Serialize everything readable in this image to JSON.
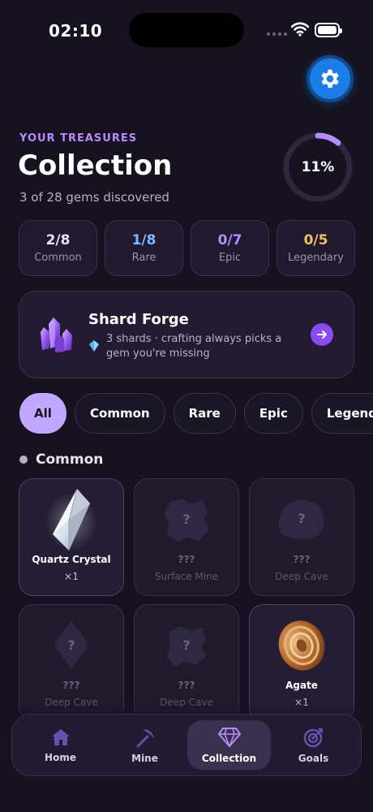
{
  "status_bar": {
    "time": "02:10"
  },
  "header": {
    "eyebrow": "YOUR TREASURES",
    "title": "Collection",
    "subtitle": "3 of 28 gems discovered",
    "progress_percent": 11,
    "progress_label": "11%"
  },
  "stats": [
    {
      "value": "2/8",
      "label": "Common",
      "color": "#e8e4f0"
    },
    {
      "value": "1/8",
      "label": "Rare",
      "color": "#7ab8ff"
    },
    {
      "value": "0/7",
      "label": "Epic",
      "color": "#b48dfb"
    },
    {
      "value": "0/5",
      "label": "Legendary",
      "color": "#f2c063"
    }
  ],
  "forge": {
    "title": "Shard Forge",
    "description": "3 shards · crafting always picks a gem you're missing"
  },
  "filters": [
    "All",
    "Common",
    "Rare",
    "Epic",
    "Legendary"
  ],
  "active_filter": "All",
  "section": {
    "title": "Common"
  },
  "gems": [
    {
      "name": "Quartz Crystal",
      "sub": "×1",
      "found": true,
      "icon": "quartz-crystal-icon"
    },
    {
      "name": "???",
      "sub": "Surface Mine",
      "found": false,
      "icon": "locked-rock-gem-icon"
    },
    {
      "name": "???",
      "sub": "Deep Cave",
      "found": false,
      "icon": "locked-pebble-gem-icon"
    },
    {
      "name": "???",
      "sub": "Deep Cave",
      "found": false,
      "icon": "locked-diamond-gem-icon"
    },
    {
      "name": "???",
      "sub": "Deep Cave",
      "found": false,
      "icon": "locked-rock-gem-icon"
    },
    {
      "name": "Agate",
      "sub": "×1",
      "found": true,
      "icon": "agate-icon"
    }
  ],
  "tabs": [
    {
      "label": "Home",
      "icon": "home-icon"
    },
    {
      "label": "Mine",
      "icon": "pickaxe-icon"
    },
    {
      "label": "Collection",
      "icon": "diamond-icon"
    },
    {
      "label": "Goals",
      "icon": "target-icon"
    }
  ],
  "active_tab": "Collection",
  "colors": {
    "accent": "#b48dfb",
    "settings_blue": "#1b7ee8",
    "background": "#16121f"
  }
}
